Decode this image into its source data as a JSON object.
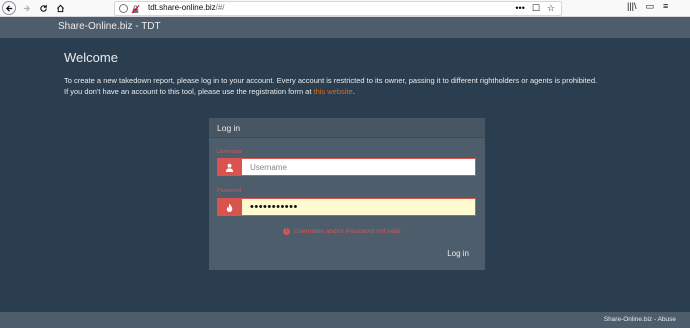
{
  "browser": {
    "url_host": "tdt.share-online.biz",
    "url_rest": "/#/",
    "actions": [
      "•••",
      "☐",
      "☆"
    ],
    "toolbar_icons": [
      "|||\\",
      "▭",
      "≡"
    ]
  },
  "header": {
    "brand": "Share-Online.biz - TDT"
  },
  "main": {
    "title": "Welcome",
    "desc_line1": "To create a new takedown report, please log in to your account. Every account is restricted to its owner, passing it to different rightholders or agents is prohibited.",
    "desc_line2_prefix": "If you don't have an account to this tool, please use the registration form at ",
    "desc_link": "this website",
    "desc_line2_suffix": "."
  },
  "login": {
    "heading": "Log in",
    "username_label": "Username",
    "username_placeholder": "Username",
    "username_value": "",
    "password_label": "Password",
    "password_value": "•••••••••••",
    "error": "Username and/or Password not valid",
    "submit": "Log in"
  },
  "footer": {
    "text": "Share-Online.biz - Abuse"
  },
  "colors": {
    "background": "#2b3e50",
    "panel": "#4e5d6c",
    "danger": "#d9534f",
    "link": "#df691a"
  }
}
